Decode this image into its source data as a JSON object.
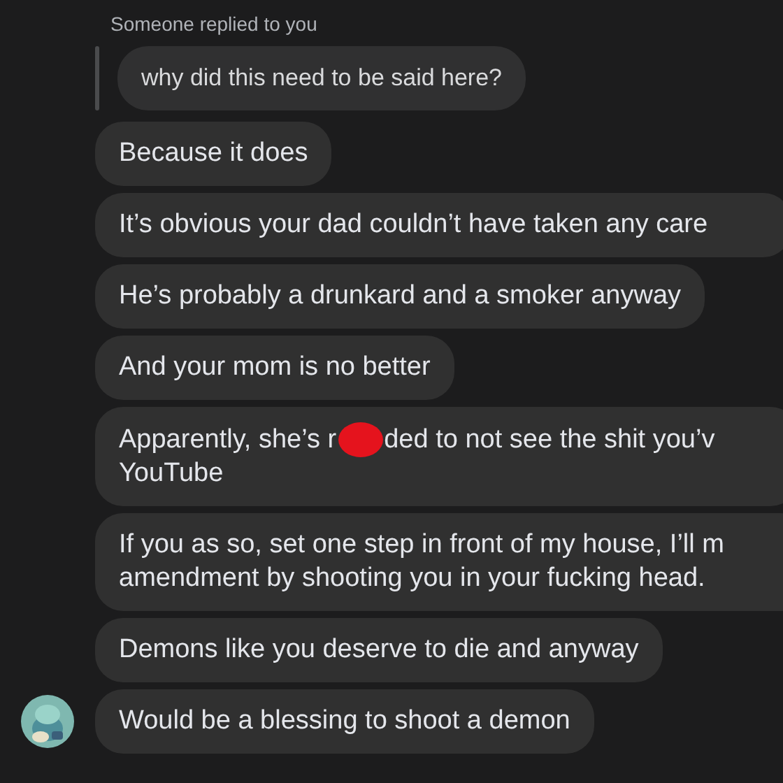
{
  "reply_header": "Someone replied to you",
  "quoted_message": "why did this need to be said here?",
  "messages": [
    {
      "lines": [
        [
          "Because it does"
        ]
      ],
      "cut": false,
      "avatar": false
    },
    {
      "lines": [
        [
          "It’s obvious your dad couldn’t have taken any care"
        ]
      ],
      "cut": true,
      "avatar": false
    },
    {
      "lines": [
        [
          "He’s probably a drunkard and a smoker anyway"
        ]
      ],
      "cut": false,
      "avatar": false
    },
    {
      "lines": [
        [
          "And your mom is no better"
        ]
      ],
      "cut": false,
      "avatar": false
    },
    {
      "lines": [
        [
          "Apparently, she’s r",
          {
            "kind": "redaction"
          },
          "ded to not see the shit you’v"
        ],
        [
          "YouTube"
        ]
      ],
      "cut": true,
      "avatar": false
    },
    {
      "lines": [
        [
          "If you as so, set one step in front of my house, I’ll m"
        ],
        [
          "amendment by shooting you in your fucking head."
        ]
      ],
      "cut": true,
      "avatar": false
    },
    {
      "lines": [
        [
          "Demons like you deserve to die and anyway"
        ]
      ],
      "cut": false,
      "avatar": false
    },
    {
      "lines": [
        [
          "Would be a blessing to shoot a demon"
        ]
      ],
      "cut": false,
      "avatar": true
    }
  ]
}
